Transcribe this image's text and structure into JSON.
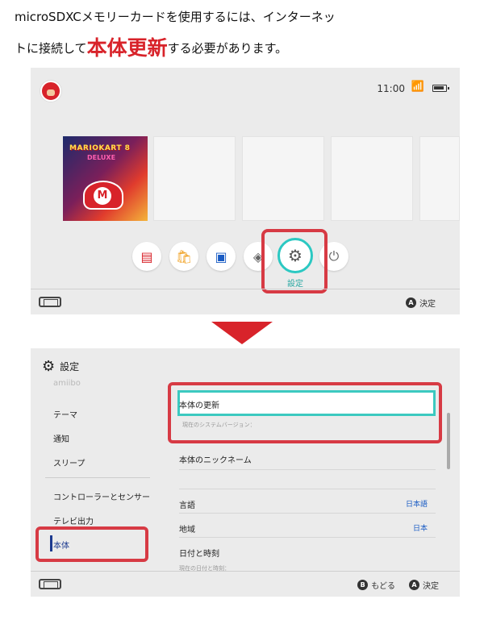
{
  "instructions": {
    "line1": "microSDXCメモリーカードを使用するには、インターネッ",
    "line2_prefix": "トに接続して",
    "line2_highlight": "本体更新",
    "line2_suffix": "する必要があります。"
  },
  "home": {
    "time": "11:00",
    "game": {
      "logo": "MARIOKART 8",
      "sub": "DELUXE"
    },
    "selected_item": "設定",
    "footer_hint": {
      "button": "A",
      "label": "決定"
    }
  },
  "settings": {
    "title": "設定",
    "sidebar_faded": "amiibo",
    "sidebar": [
      "テーマ",
      "通知",
      "スリープ",
      "コントローラーとセンサー",
      "テレビ出力",
      "本体"
    ],
    "main": {
      "update_label": "本体の更新",
      "current_version": "現在のシステムバージョン：",
      "nickname": "本体のニックネーム",
      "language": {
        "label": "言語",
        "value": "日本語"
      },
      "region": {
        "label": "地域",
        "value": "日本"
      },
      "datetime": "日付と時刻",
      "datetime_sub": "現在の日付と時刻："
    },
    "footer": {
      "back_button": "B",
      "back_label": "もどる",
      "ok_button": "A",
      "ok_label": "決定"
    }
  },
  "colors": {
    "highlight_red": "#d8232a",
    "selection_teal": "#3cc9c0",
    "value_blue": "#1a5cc4"
  }
}
